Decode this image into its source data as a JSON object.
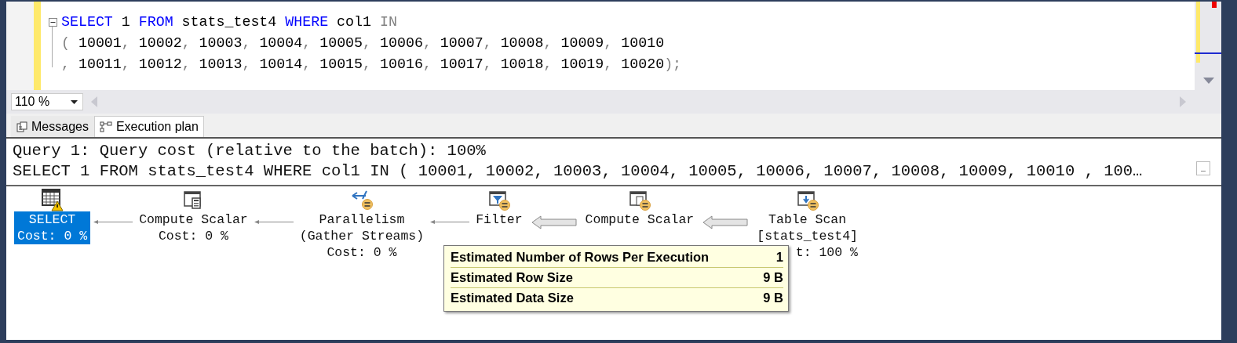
{
  "editor": {
    "lines": [
      [
        {
          "kind": "keyword",
          "t": "SELECT"
        },
        {
          "kind": "plain",
          "t": " 1 "
        },
        {
          "kind": "keyword",
          "t": "FROM"
        },
        {
          "kind": "plain",
          "t": " stats_test4 "
        },
        {
          "kind": "keyword",
          "t": "WHERE"
        },
        {
          "kind": "plain",
          "t": " col1 "
        },
        {
          "kind": "punct",
          "t": "IN"
        }
      ],
      [
        {
          "kind": "punct",
          "t": "( "
        },
        {
          "kind": "plain",
          "t": "10001"
        },
        {
          "kind": "punct",
          "t": ", "
        },
        {
          "kind": "plain",
          "t": "10002"
        },
        {
          "kind": "punct",
          "t": ", "
        },
        {
          "kind": "plain",
          "t": "10003"
        },
        {
          "kind": "punct",
          "t": ", "
        },
        {
          "kind": "plain",
          "t": "10004"
        },
        {
          "kind": "punct",
          "t": ", "
        },
        {
          "kind": "plain",
          "t": "10005"
        },
        {
          "kind": "punct",
          "t": ", "
        },
        {
          "kind": "plain",
          "t": "10006"
        },
        {
          "kind": "punct",
          "t": ", "
        },
        {
          "kind": "plain",
          "t": "10007"
        },
        {
          "kind": "punct",
          "t": ", "
        },
        {
          "kind": "plain",
          "t": "10008"
        },
        {
          "kind": "punct",
          "t": ", "
        },
        {
          "kind": "plain",
          "t": "10009"
        },
        {
          "kind": "punct",
          "t": ", "
        },
        {
          "kind": "plain",
          "t": "10010"
        }
      ],
      [
        {
          "kind": "punct",
          "t": ", "
        },
        {
          "kind": "plain",
          "t": "10011"
        },
        {
          "kind": "punct",
          "t": ", "
        },
        {
          "kind": "plain",
          "t": "10012"
        },
        {
          "kind": "punct",
          "t": ", "
        },
        {
          "kind": "plain",
          "t": "10013"
        },
        {
          "kind": "punct",
          "t": ", "
        },
        {
          "kind": "plain",
          "t": "10014"
        },
        {
          "kind": "punct",
          "t": ", "
        },
        {
          "kind": "plain",
          "t": "10015"
        },
        {
          "kind": "punct",
          "t": ", "
        },
        {
          "kind": "plain",
          "t": "10016"
        },
        {
          "kind": "punct",
          "t": ", "
        },
        {
          "kind": "plain",
          "t": "10017"
        },
        {
          "kind": "punct",
          "t": ", "
        },
        {
          "kind": "plain",
          "t": "10018"
        },
        {
          "kind": "punct",
          "t": ", "
        },
        {
          "kind": "plain",
          "t": "10019"
        },
        {
          "kind": "punct",
          "t": ", "
        },
        {
          "kind": "plain",
          "t": "10020"
        },
        {
          "kind": "punct",
          "t": ");"
        }
      ]
    ],
    "collapsed": false
  },
  "zoom": {
    "value": "110 %"
  },
  "tabs": [
    {
      "label": "Messages",
      "kind": "messages",
      "selected": false
    },
    {
      "label": "Execution plan",
      "kind": "plan",
      "selected": true
    }
  ],
  "plan": {
    "header": [
      "Query 1: Query cost (relative to the batch): 100%",
      "SELECT 1 FROM stats_test4 WHERE col1 IN ( 10001, 10002, 10003, 10004, 10005, 10006, 10007, 10008, 10009, 10010 , 100…"
    ],
    "nodes": [
      {
        "kind": "select",
        "lines": [
          {
            "text": "SELECT"
          },
          {
            "text": "Cost: 0 %"
          }
        ],
        "selected": true
      },
      {
        "kind": "compute",
        "lines": [
          {
            "text": "Compute Scalar"
          },
          {
            "text": "Cost: 0 %"
          }
        ],
        "selected": false
      },
      {
        "kind": "parallelism",
        "lines": [
          {
            "text": "Parallelism"
          },
          {
            "text": "(Gather Streams)"
          },
          {
            "text": "Cost: 0 %"
          }
        ],
        "selected": false
      },
      {
        "kind": "filter",
        "lines": [
          {
            "text": "Filter"
          }
        ],
        "selected": false
      },
      {
        "kind": "compute2",
        "lines": [
          {
            "text": "Compute Scalar"
          }
        ],
        "selected": false
      },
      {
        "kind": "scan",
        "lines": [
          {
            "text": "Table Scan"
          },
          {
            "text": "[stats_test4]"
          },
          {
            "text": "t: 100 %",
            "cut": true
          }
        ],
        "selected": false
      }
    ],
    "edges": [
      {
        "kind": "thin"
      },
      {
        "kind": "thin"
      },
      {
        "kind": "thin"
      },
      {
        "kind": "thick"
      },
      {
        "kind": "thick"
      }
    ],
    "tooltip": [
      {
        "label": "Estimated Number of Rows Per Execution",
        "value": "1"
      },
      {
        "label": "Estimated Row Size",
        "value": "9 B"
      },
      {
        "label": "Estimated Data Size",
        "value": "9 B"
      }
    ]
  }
}
